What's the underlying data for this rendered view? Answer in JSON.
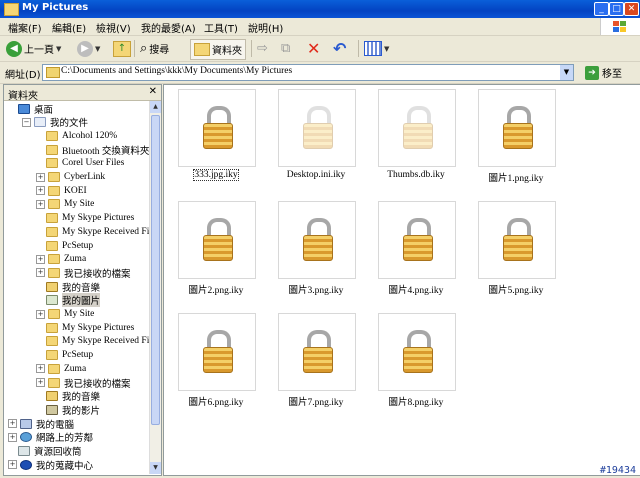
{
  "window": {
    "title": "My Pictures"
  },
  "menu": [
    "檔案(F)",
    "編輯(E)",
    "檢視(V)",
    "我的最愛(A)",
    "工具(T)",
    "說明(H)"
  ],
  "toolbar": {
    "back": "上一頁",
    "search": "搜尋",
    "folders": "資料夾"
  },
  "address": {
    "label": "網址(D)",
    "path": "C:\\Documents and Settings\\kkk\\My Documents\\My Pictures",
    "go": "移至"
  },
  "folder_panel": {
    "title": "資料夾",
    "tree": [
      {
        "label": "桌面",
        "indent": 0,
        "expand": "none",
        "icon": "desk"
      },
      {
        "label": "我的文件",
        "indent": 1,
        "expand": "minus",
        "icon": "doc"
      },
      {
        "label": "Alcohol 120%",
        "indent": 2,
        "expand": "none",
        "icon": "folder"
      },
      {
        "label": "Bluetooth 交換資料夾",
        "indent": 2,
        "expand": "none",
        "icon": "folder"
      },
      {
        "label": "Corel User Files",
        "indent": 2,
        "expand": "none",
        "icon": "folder"
      },
      {
        "label": "CyberLink",
        "indent": 2,
        "expand": "plus",
        "icon": "folder"
      },
      {
        "label": "KOEI",
        "indent": 2,
        "expand": "plus",
        "icon": "folder"
      },
      {
        "label": "My Site",
        "indent": 2,
        "expand": "plus",
        "icon": "folder"
      },
      {
        "label": "My Skype Pictures",
        "indent": 2,
        "expand": "none",
        "icon": "folder"
      },
      {
        "label": "My Skype Received Files",
        "indent": 2,
        "expand": "none",
        "icon": "folder"
      },
      {
        "label": "PcSetup",
        "indent": 2,
        "expand": "none",
        "icon": "folder"
      },
      {
        "label": "Zuma",
        "indent": 2,
        "expand": "plus",
        "icon": "folder"
      },
      {
        "label": "我已接收的檔案",
        "indent": 2,
        "expand": "plus",
        "icon": "folder"
      },
      {
        "label": "我的音樂",
        "indent": 2,
        "expand": "none",
        "icon": "music"
      },
      {
        "label": "我的圖片",
        "indent": 2,
        "expand": "none",
        "icon": "pic",
        "selected": true
      },
      {
        "label": "My Site",
        "indent": 2,
        "expand": "plus",
        "icon": "folder"
      },
      {
        "label": "My Skype Pictures",
        "indent": 2,
        "expand": "none",
        "icon": "folder"
      },
      {
        "label": "My Skype Received Files",
        "indent": 2,
        "expand": "none",
        "icon": "folder"
      },
      {
        "label": "PcSetup",
        "indent": 2,
        "expand": "none",
        "icon": "folder"
      },
      {
        "label": "Zuma",
        "indent": 2,
        "expand": "plus",
        "icon": "folder"
      },
      {
        "label": "我已接收的檔案",
        "indent": 2,
        "expand": "plus",
        "icon": "folder"
      },
      {
        "label": "我的音樂",
        "indent": 2,
        "expand": "none",
        "icon": "music"
      },
      {
        "label": "我的影片",
        "indent": 2,
        "expand": "none",
        "icon": "vid"
      },
      {
        "label": "我的電腦",
        "indent": 0,
        "expand": "plus",
        "icon": "pc"
      },
      {
        "label": "網路上的芳鄰",
        "indent": 0,
        "expand": "plus",
        "icon": "net"
      },
      {
        "label": "資源回收筒",
        "indent": 0,
        "expand": "none",
        "icon": "bin"
      },
      {
        "label": "我的蒐藏中心",
        "indent": 0,
        "expand": "plus",
        "icon": "fav"
      }
    ]
  },
  "files": [
    {
      "name": "333.jpg.iky",
      "faded": false,
      "selected": true
    },
    {
      "name": "Desktop.ini.iky",
      "faded": true
    },
    {
      "name": "Thumbs.db.iky",
      "faded": true
    },
    {
      "name": "圖片1.png.iky",
      "faded": false
    },
    {
      "name": "圖片2.png.iky",
      "faded": false
    },
    {
      "name": "圖片3.png.iky",
      "faded": false
    },
    {
      "name": "圖片4.png.iky",
      "faded": false
    },
    {
      "name": "圖片5.png.iky",
      "faded": false
    },
    {
      "name": "圖片6.png.iky",
      "faded": false
    },
    {
      "name": "圖片7.png.iky",
      "faded": false
    },
    {
      "name": "圖片8.png.iky",
      "faded": false
    }
  ],
  "badge": "#19434"
}
